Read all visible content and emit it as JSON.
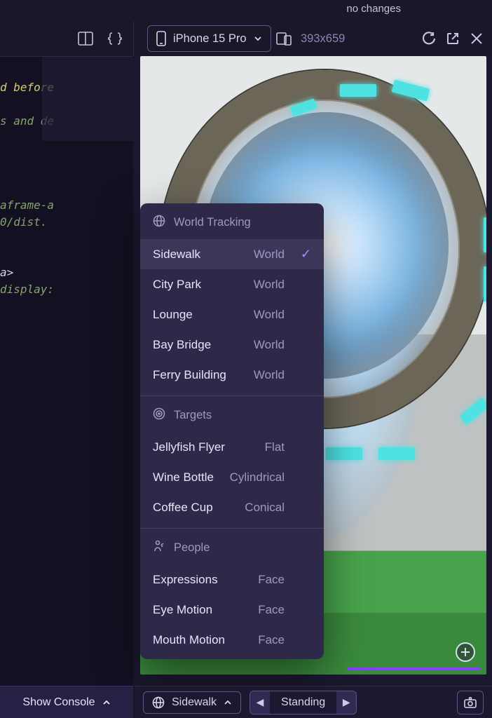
{
  "status": {
    "text": "no changes"
  },
  "toolbar": {
    "device_label": "iPhone 15 Pro",
    "dimensions": "393x659"
  },
  "code": {
    "lines": [
      {
        "text": "",
        "cls": ""
      },
      {
        "text": "d before",
        "cls": "tok-attr"
      },
      {
        "text": "",
        "cls": ""
      },
      {
        "text": "s and de",
        "cls": "tok-str"
      },
      {
        "text": "",
        "cls": ""
      },
      {
        "text": "",
        "cls": ""
      },
      {
        "text": "",
        "cls": ""
      },
      {
        "text": "",
        "cls": ""
      },
      {
        "text": "aframe-a",
        "cls": "tok-str"
      },
      {
        "text": "0/dist.",
        "cls": "tok-str"
      },
      {
        "text": "",
        "cls": ""
      },
      {
        "text": "",
        "cls": ""
      },
      {
        "text": "a>",
        "cls": "tok-tag"
      },
      {
        "text": "display:",
        "cls": "tok-str"
      }
    ]
  },
  "dropdown": {
    "sections": [
      {
        "title": "World Tracking",
        "icon": "globe",
        "items": [
          {
            "name": "Sidewalk",
            "type": "World",
            "selected": true
          },
          {
            "name": "City Park",
            "type": "World",
            "selected": false
          },
          {
            "name": "Lounge",
            "type": "World",
            "selected": false
          },
          {
            "name": "Bay Bridge",
            "type": "World",
            "selected": false
          },
          {
            "name": "Ferry Building",
            "type": "World",
            "selected": false
          }
        ]
      },
      {
        "title": "Targets",
        "icon": "target",
        "items": [
          {
            "name": "Jellyfish Flyer",
            "type": "Flat",
            "selected": false
          },
          {
            "name": "Wine Bottle",
            "type": "Cylindrical",
            "selected": false
          },
          {
            "name": "Coffee Cup",
            "type": "Conical",
            "selected": false
          }
        ]
      },
      {
        "title": "People",
        "icon": "person",
        "items": [
          {
            "name": "Expressions",
            "type": "Face",
            "selected": false
          },
          {
            "name": "Eye Motion",
            "type": "Face",
            "selected": false
          },
          {
            "name": "Mouth Motion",
            "type": "Face",
            "selected": false
          }
        ]
      }
    ]
  },
  "footer": {
    "console_label": "Show Console",
    "scene_label": "Sidewalk",
    "pose_label": "Standing"
  }
}
